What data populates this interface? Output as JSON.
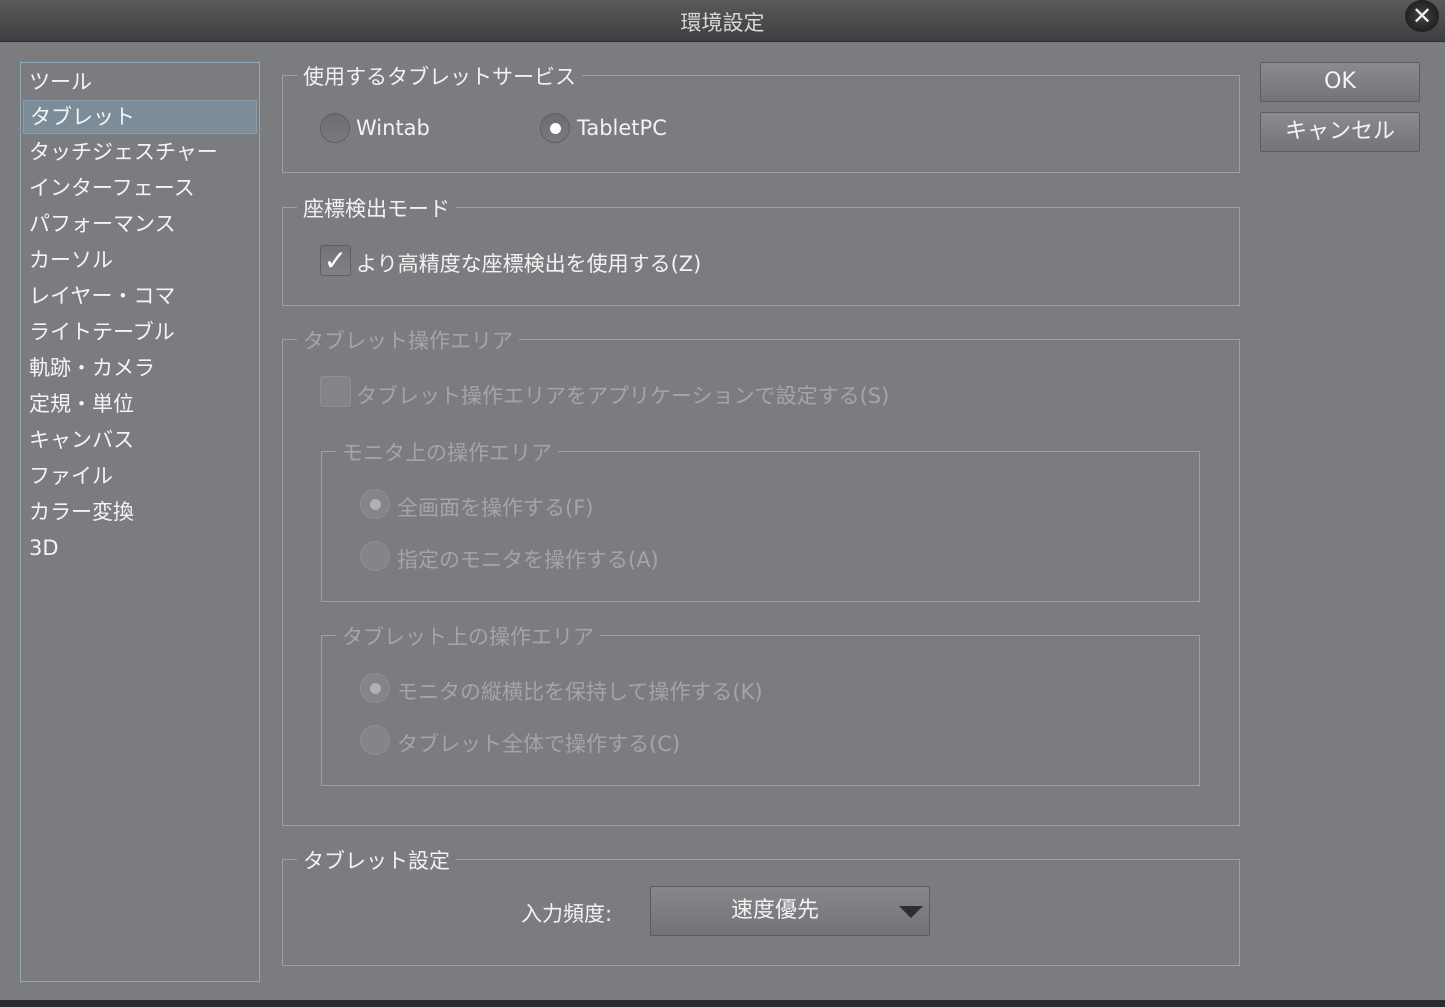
{
  "window": {
    "title": "環境設定",
    "close_icon": "close-icon"
  },
  "sidebar": {
    "items": [
      {
        "label": "ツール"
      },
      {
        "label": "タブレット",
        "selected": true
      },
      {
        "label": "タッチジェスチャー"
      },
      {
        "label": "インターフェース"
      },
      {
        "label": "パフォーマンス"
      },
      {
        "label": "カーソル"
      },
      {
        "label": "レイヤー・コマ"
      },
      {
        "label": "ライトテーブル"
      },
      {
        "label": "軌跡・カメラ"
      },
      {
        "label": "定規・単位"
      },
      {
        "label": "キャンバス"
      },
      {
        "label": "ファイル"
      },
      {
        "label": "カラー変換"
      },
      {
        "label": "3D"
      }
    ]
  },
  "tablet_service": {
    "legend": "使用するタブレットサービス",
    "options": [
      {
        "label": "Wintab",
        "checked": false
      },
      {
        "label": "TabletPC",
        "checked": true
      }
    ]
  },
  "coordinate_mode": {
    "legend": "座標検出モード",
    "checkbox": {
      "label": "より高精度な座標検出を使用する(Z)",
      "checked": true
    }
  },
  "operation_area": {
    "legend": "タブレット操作エリア",
    "checkbox": {
      "label": "タブレット操作エリアをアプリケーションで設定する(S)",
      "checked": false
    },
    "monitor": {
      "legend": "モニタ上の操作エリア",
      "options": [
        {
          "label": "全画面を操作する(F)",
          "checked": true
        },
        {
          "label": "指定のモニタを操作する(A)",
          "checked": false
        }
      ]
    },
    "tablet": {
      "legend": "タブレット上の操作エリア",
      "options": [
        {
          "label": "モニタの縦横比を保持して操作する(K)",
          "checked": true
        },
        {
          "label": "タブレット全体で操作する(C)",
          "checked": false
        }
      ]
    }
  },
  "tablet_settings": {
    "legend": "タブレット設定",
    "input_frequency_label": "入力頻度:",
    "input_frequency_value": "速度優先"
  },
  "buttons": {
    "ok": "OK",
    "cancel": "キャンセル"
  }
}
